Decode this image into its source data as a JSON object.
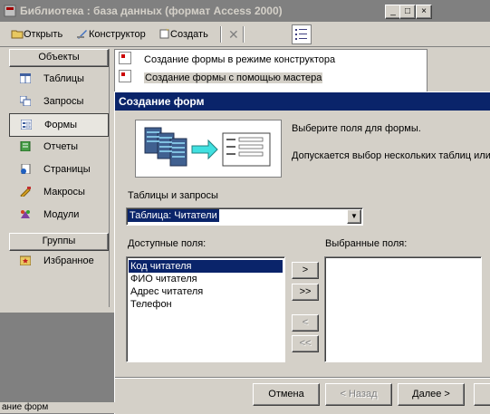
{
  "db_window": {
    "title": "Библиотека : база данных (формат Access 2000)",
    "controls": {
      "minimize": "_",
      "maximize": "□",
      "close": "×"
    }
  },
  "toolbar": {
    "open": "Открыть",
    "designer": "Конструктор",
    "create": "Создать"
  },
  "objects_panel": {
    "header": "Объекты",
    "items": [
      {
        "label": "Таблицы",
        "icon": "table-icon"
      },
      {
        "label": "Запросы",
        "icon": "query-icon"
      },
      {
        "label": "Формы",
        "icon": "form-icon"
      },
      {
        "label": "Отчеты",
        "icon": "report-icon"
      },
      {
        "label": "Страницы",
        "icon": "page-icon"
      },
      {
        "label": "Макросы",
        "icon": "macro-icon"
      },
      {
        "label": "Модули",
        "icon": "module-icon"
      }
    ],
    "groups_header": "Группы",
    "favorites": "Избранное"
  },
  "object_list": {
    "items": [
      "Создание формы в режиме конструктора",
      "Создание формы с помощью мастера"
    ]
  },
  "wizard": {
    "title": "Создание форм",
    "hint1": "Выберите поля для формы.",
    "hint2": "Допускается выбор нескольких таблиц или",
    "tables_label": "Таблицы и запросы",
    "table_selected": "Таблица: Читатели",
    "available_label": "Доступные поля:",
    "selected_label": "Выбранные поля:",
    "available_fields": [
      "Код читателя",
      "ФИО читателя",
      "Адрес читателя",
      "Телефон"
    ],
    "move_buttons": {
      "one": ">",
      "all": ">>",
      "back": "<",
      "back_all": "<<"
    },
    "buttons": {
      "cancel": "Отмена",
      "back": "< Назад",
      "next": "Далее >"
    }
  },
  "status_bar": {
    "text": "ание форм"
  },
  "colors": {
    "title_active": "#0a246a",
    "face": "#d4d0c8",
    "desktop": "#808080"
  }
}
